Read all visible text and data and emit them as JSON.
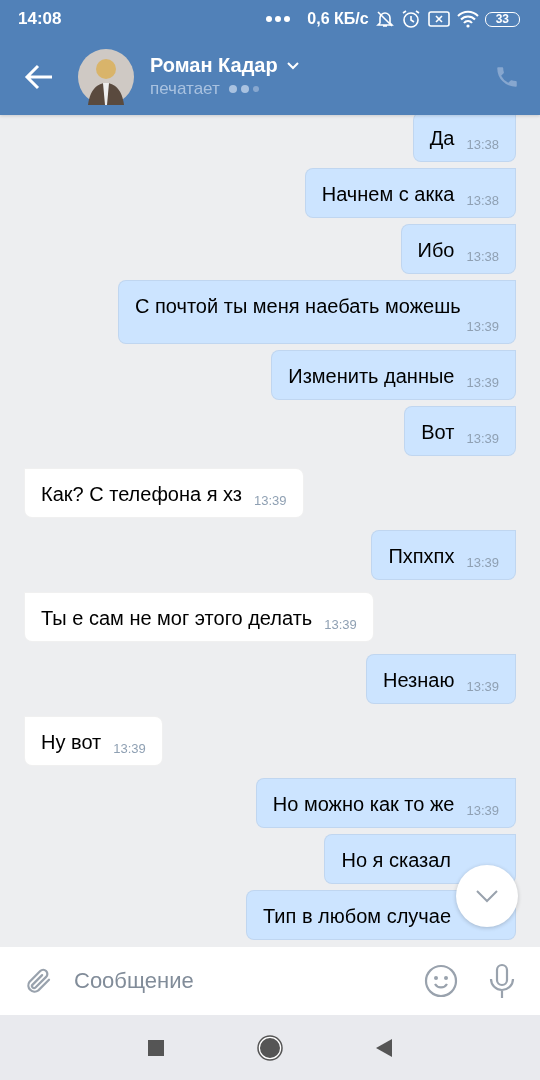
{
  "status_bar": {
    "time": "14:08",
    "speed": "0,6 КБ/с",
    "battery": "33"
  },
  "header": {
    "name": "Роман Кадар",
    "status": "печатает"
  },
  "messages": [
    {
      "kind": "out",
      "text": "Да",
      "time": "13:38"
    },
    {
      "kind": "out",
      "text": "Начнем с акка",
      "time": "13:38"
    },
    {
      "kind": "out",
      "text": "Ибо",
      "time": "13:38"
    },
    {
      "kind": "out",
      "text": "С почтой ты меня наебать можешь",
      "time": "13:39"
    },
    {
      "kind": "out",
      "text": "Изменить данные",
      "time": "13:39"
    },
    {
      "kind": "out",
      "text": "Вот",
      "time": "13:39"
    },
    {
      "kind": "in",
      "text": "Как? С телефона я хз",
      "time": "13:39"
    },
    {
      "kind": "out",
      "text": "Пхпхпх",
      "time": "13:39"
    },
    {
      "kind": "in",
      "text": "Ты е сам не мог этого делать",
      "time": "13:39"
    },
    {
      "kind": "out",
      "text": "Незнаю",
      "time": "13:39"
    },
    {
      "kind": "in",
      "text": "Ну вот",
      "time": "13:39"
    },
    {
      "kind": "out",
      "text": "Но можно как то же",
      "time": "13:39"
    },
    {
      "kind": "out",
      "text": "Но я сказал"
    },
    {
      "kind": "out",
      "text": "Тип в любом случае"
    }
  ],
  "composer": {
    "placeholder": "Сообщение"
  }
}
